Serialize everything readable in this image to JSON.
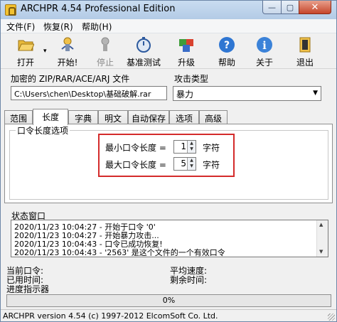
{
  "window": {
    "title": "ARCHPR 4.54 Professional Edition",
    "minimize": "—",
    "maximize": "▢",
    "close": "✕"
  },
  "menu": [
    "文件(F)",
    "恢复(R)",
    "帮助(H)"
  ],
  "toolbar": [
    {
      "label": "打开",
      "icon": "folder-open-icon",
      "enabled": true
    },
    {
      "label": "开始!",
      "icon": "start-runner-icon",
      "enabled": true
    },
    {
      "label": "停止",
      "icon": "stop-runner-icon",
      "enabled": false
    },
    {
      "label": "基准测试",
      "icon": "stopwatch-icon",
      "enabled": true
    },
    {
      "label": "升级",
      "icon": "upgrade-cards-icon",
      "enabled": true
    },
    {
      "label": "帮助",
      "icon": "help-icon",
      "enabled": true
    },
    {
      "label": "关于",
      "icon": "info-icon",
      "enabled": true
    },
    {
      "label": "退出",
      "icon": "exit-door-icon",
      "enabled": true
    }
  ],
  "encrypted_file": {
    "label": "加密的 ZIP/RAR/ACE/ARJ 文件",
    "value": "C:\\Users\\chen\\Desktop\\基础破解.rar"
  },
  "attack_type": {
    "label": "攻击类型",
    "value": "暴力"
  },
  "tabs": [
    "范围",
    "长度",
    "字典",
    "明文",
    "自动保存",
    "选项",
    "高级"
  ],
  "active_tab": "长度",
  "length_options": {
    "group_title": "口令长度选项",
    "min_label": "最小口令长度 =",
    "min_value": "1",
    "max_label": "最大口令长度 =",
    "max_value": "5",
    "unit": "字符"
  },
  "status": {
    "title": "状态窗口",
    "log": [
      "2020/11/23 10:04:27 - 开始于口令 '0'",
      "2020/11/23 10:04:27 - 开始暴力攻击...",
      "2020/11/23 10:04:43 - 口令已成功恢复!",
      "2020/11/23 10:04:43 - '2563' 是这个文件的一个有效口令"
    ]
  },
  "info": {
    "current_password": "当前口令:",
    "avg_speed": "平均速度:",
    "elapsed_time": "已用时间:",
    "remaining_time": "剩余时间:",
    "progress_label": "进度指示器"
  },
  "progress": {
    "value": 0,
    "text": "0%"
  },
  "footer": "ARCHPR version 4.54 (c) 1997-2012 ElcomSoft Co. Ltd."
}
